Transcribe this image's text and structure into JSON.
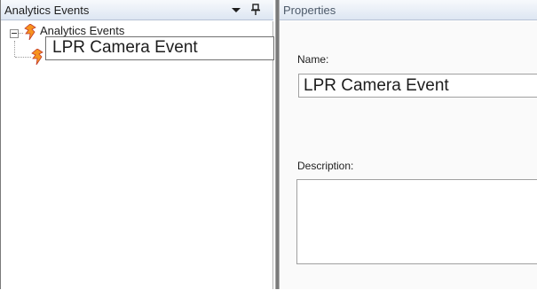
{
  "left_panel": {
    "title": "Analytics Events",
    "dropdown_icon": "dropdown-arrow-icon",
    "pin_icon": "pin-icon",
    "tree": {
      "root": {
        "label": "Analytics Events",
        "icon": "analytics-event-icon",
        "expanded": true
      },
      "child": {
        "label": "LPR Camera Event",
        "icon": "analytics-event-icon",
        "editing": true
      }
    }
  },
  "right_panel": {
    "title": "Properties",
    "name_field": {
      "label": "Name:",
      "value": "LPR Camera Event"
    },
    "description_field": {
      "label": "Description:",
      "value": ""
    }
  },
  "colors": {
    "header_top": "#f7f9fc",
    "header_bottom": "#dde6f2",
    "icon_orange": "#f7931e",
    "icon_red": "#c0392b",
    "splitter": "#7a7a7a"
  }
}
